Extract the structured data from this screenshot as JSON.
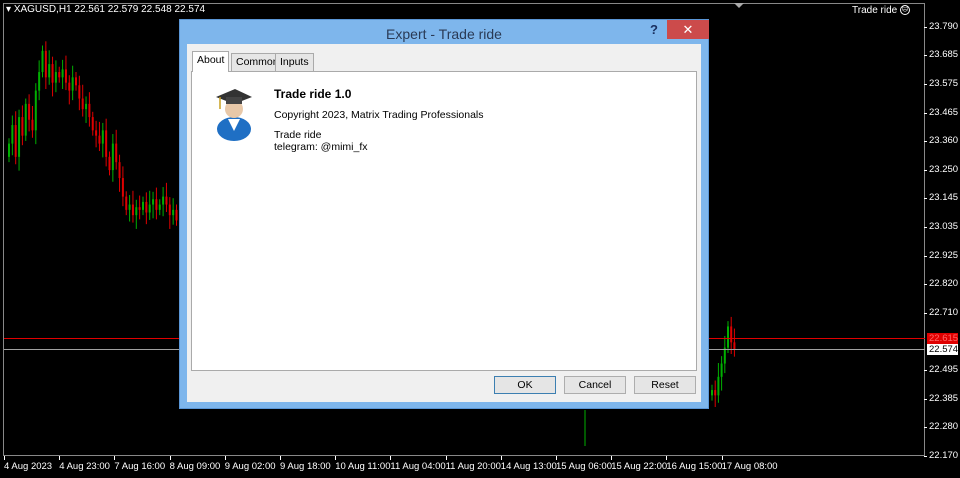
{
  "chart": {
    "symbol_line": "XAGUSD,H1  22.561 22.579 22.548 22.574",
    "ea_label": "Trade ride",
    "ea_status_icon": "sad-face-icon",
    "price_labels": [
      "23.790",
      "23.685",
      "23.575",
      "23.465",
      "23.360",
      "23.250",
      "23.145",
      "23.035",
      "22.925",
      "22.820",
      "22.710",
      "22.495",
      "22.385",
      "22.280",
      "22.170"
    ],
    "price_values": [
      23.79,
      23.685,
      23.575,
      23.465,
      23.36,
      23.25,
      23.145,
      23.035,
      22.925,
      22.82,
      22.71,
      22.495,
      22.385,
      22.28,
      22.17
    ],
    "ask_label": "22.615",
    "ask_value": 22.615,
    "bid_label": "22.574",
    "bid_value": 22.574,
    "time_labels": [
      "4 Aug 2023",
      "4 Aug 23:00",
      "7 Aug 16:00",
      "8 Aug 09:00",
      "9 Aug 02:00",
      "9 Aug 18:00",
      "10 Aug 11:00",
      "11 Aug 04:00",
      "11 Aug 20:00",
      "14 Aug 13:00",
      "15 Aug 06:00",
      "15 Aug 22:00",
      "16 Aug 15:00",
      "17 Aug 08:00"
    ],
    "closes_left": [
      23.35,
      23.42,
      23.3,
      23.45,
      23.38,
      23.5,
      23.44,
      23.4,
      23.55,
      23.62,
      23.7,
      23.6,
      23.65,
      23.58,
      23.62,
      23.6,
      23.63,
      23.58,
      23.55,
      23.6,
      23.57,
      23.52,
      23.48,
      23.5,
      23.45,
      23.4,
      23.38,
      23.35,
      23.4,
      23.3,
      23.25,
      23.35,
      23.28,
      23.22,
      23.15,
      23.1,
      23.12,
      23.08,
      23.11,
      23.1,
      23.13,
      23.09,
      23.12,
      23.14,
      23.1,
      23.12,
      23.15,
      23.12,
      23.08,
      23.1,
      23.06
    ],
    "closes_right": [
      22.42,
      22.4,
      22.47,
      22.52,
      22.58,
      22.66,
      22.6,
      22.574
    ],
    "colors": {
      "up": "#00b000",
      "down": "#e00000",
      "ask": "#e00000",
      "bid": "#a0a0a0"
    }
  },
  "dialog": {
    "title": "Expert - Trade ride",
    "help": "?",
    "close": "✕",
    "tabs": [
      "About",
      "Common",
      "Inputs"
    ],
    "ea_name": "Trade ride 1.0",
    "copyright": "Copyright 2023, Matrix Trading Professionals",
    "description": "Trade ride",
    "contact": "telegram: @mimi_fx",
    "buttons": {
      "ok": "OK",
      "cancel": "Cancel",
      "reset": "Reset"
    }
  }
}
